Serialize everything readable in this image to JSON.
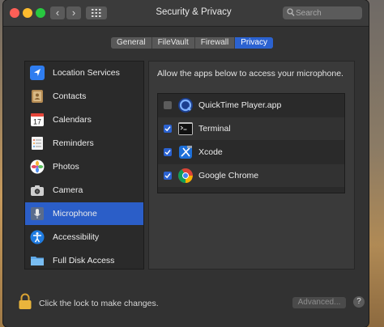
{
  "window": {
    "title": "Security & Privacy"
  },
  "toolbar": {
    "back_glyph": "‹",
    "forward_glyph": "›",
    "search_placeholder": "Search"
  },
  "tabs": [
    {
      "label": "General",
      "active": false
    },
    {
      "label": "FileVault",
      "active": false
    },
    {
      "label": "Firewall",
      "active": false
    },
    {
      "label": "Privacy",
      "active": true
    }
  ],
  "sidebar": {
    "items": [
      {
        "label": "Location Services",
        "icon": "location-arrow-icon"
      },
      {
        "label": "Contacts",
        "icon": "contacts-book-icon"
      },
      {
        "label": "Calendars",
        "icon": "calendar-icon"
      },
      {
        "label": "Reminders",
        "icon": "reminders-list-icon"
      },
      {
        "label": "Photos",
        "icon": "photos-flower-icon"
      },
      {
        "label": "Camera",
        "icon": "camera-icon"
      },
      {
        "label": "Microphone",
        "icon": "microphone-icon",
        "selected": true
      },
      {
        "label": "Accessibility",
        "icon": "accessibility-icon"
      },
      {
        "label": "Full Disk Access",
        "icon": "folder-icon"
      }
    ]
  },
  "main": {
    "prompt": "Allow the apps below to access your microphone.",
    "apps": [
      {
        "name": "QuickTime Player.app",
        "checked": false,
        "icon": "quicktime-icon"
      },
      {
        "name": "Terminal",
        "checked": true,
        "icon": "terminal-icon"
      },
      {
        "name": "Xcode",
        "checked": true,
        "icon": "xcode-icon"
      },
      {
        "name": "Google Chrome",
        "checked": true,
        "icon": "chrome-icon"
      }
    ]
  },
  "footer": {
    "lock_text": "Click the lock to make changes.",
    "advanced_label": "Advanced...",
    "help_label": "?"
  },
  "colors": {
    "accent": "#2b62d0",
    "window_bg": "#323232",
    "close": "#fe5f57",
    "minimize": "#febc2e",
    "zoom": "#28c840"
  }
}
